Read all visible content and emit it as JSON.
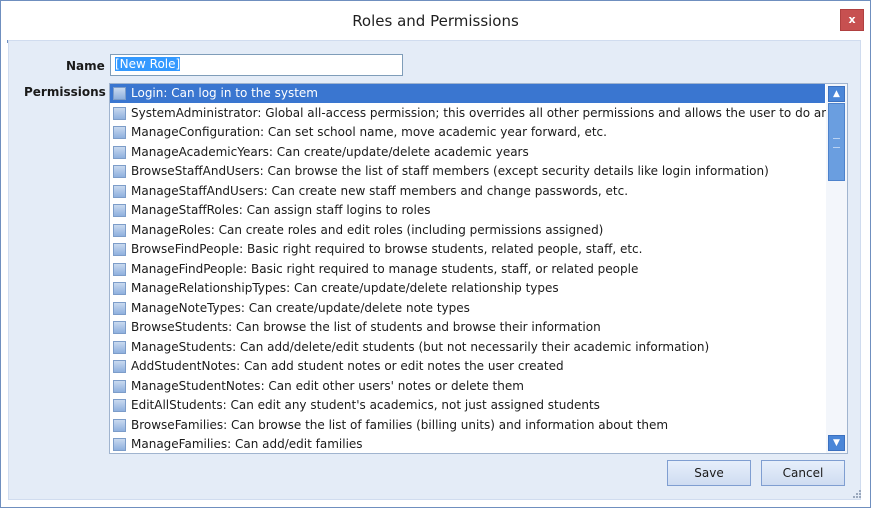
{
  "window": {
    "title": "Roles and Permissions",
    "close_glyph": "x"
  },
  "form": {
    "name_label": "Name",
    "name_value": "[New Role]",
    "permissions_label": "Permissions"
  },
  "permissions": [
    "Login: Can log in to the system",
    "SystemAdministrator: Global all-access permission; this overrides all other permissions and allows the user to do anything",
    "ManageConfiguration: Can set school name, move academic year forward, etc.",
    "ManageAcademicYears: Can create/update/delete academic years",
    "BrowseStaffAndUsers: Can browse the list of staff members (except security details like login information)",
    "ManageStaffAndUsers: Can create new staff members and change passwords, etc.",
    "ManageStaffRoles: Can assign staff logins to roles",
    "ManageRoles: Can create roles and edit roles (including permissions assigned)",
    "BrowseFindPeople: Basic right required to browse students, related people, staff, etc.",
    "ManageFindPeople: Basic right required to manage students, staff, or related people",
    "ManageRelationshipTypes: Can create/update/delete relationship types",
    "ManageNoteTypes: Can create/update/delete note types",
    "BrowseStudents: Can browse the list of students and browse their information",
    "ManageStudents: Can add/delete/edit students (but not necessarily their academic information)",
    "AddStudentNotes: Can add student notes or edit notes the user created",
    "ManageStudentNotes: Can edit other users' notes or delete them",
    "EditAllStudents: Can edit any student's academics, not just assigned students",
    "BrowseFamilies: Can browse the list of families (billing units) and information about them",
    "ManageFamilies: Can add/edit families"
  ],
  "buttons": {
    "save": "Save",
    "cancel": "Cancel"
  },
  "colors": {
    "accent": "#3a76d0",
    "close": "#c75050",
    "panel": "#e4ecf7"
  }
}
